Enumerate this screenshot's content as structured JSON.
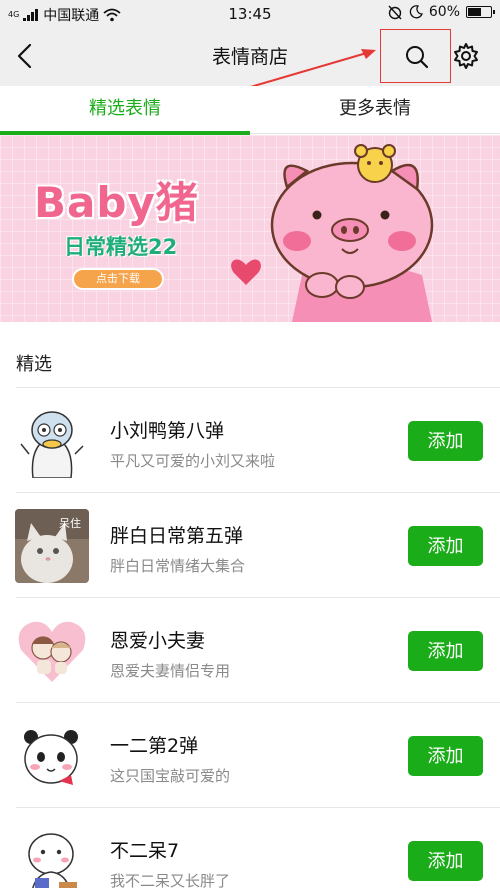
{
  "status_bar": {
    "signal_tag": "4G",
    "carrier": "中国联通",
    "time": "13:45",
    "battery": "60%",
    "battery_level": 0.6
  },
  "nav": {
    "title": "表情商店"
  },
  "tabs": [
    {
      "label": "精选表情",
      "active": true
    },
    {
      "label": "更多表情",
      "active": false
    }
  ],
  "banner": {
    "title": "Baby猪",
    "subtitle": "日常精选22",
    "button": "点击下载"
  },
  "section": {
    "title": "精选"
  },
  "items": [
    {
      "name": "小刘鸭第八弹",
      "desc": "平凡又可爱的小刘又来啦",
      "button": "添加",
      "thumb_icon": "duck-sticker-icon"
    },
    {
      "name": "胖白日常第五弹",
      "desc": "胖白日常情绪大集合",
      "button": "添加",
      "thumb_icon": "cat-photo-icon",
      "thumb_caption": "呆住"
    },
    {
      "name": "恩爱小夫妻",
      "desc": "恩爱夫妻情侣专用",
      "button": "添加",
      "thumb_icon": "couple-heart-icon"
    },
    {
      "name": "一二第2弹",
      "desc": "这只国宝敲可爱的",
      "button": "添加",
      "thumb_icon": "panda-sticker-icon"
    },
    {
      "name": "不二呆7",
      "desc": "我不二呆又长胖了",
      "button": "添加",
      "thumb_icon": "chubby-character-icon"
    }
  ],
  "colors": {
    "accent": "#1aad19",
    "annotation": "#e53935",
    "nav_bg": "#efefef"
  }
}
